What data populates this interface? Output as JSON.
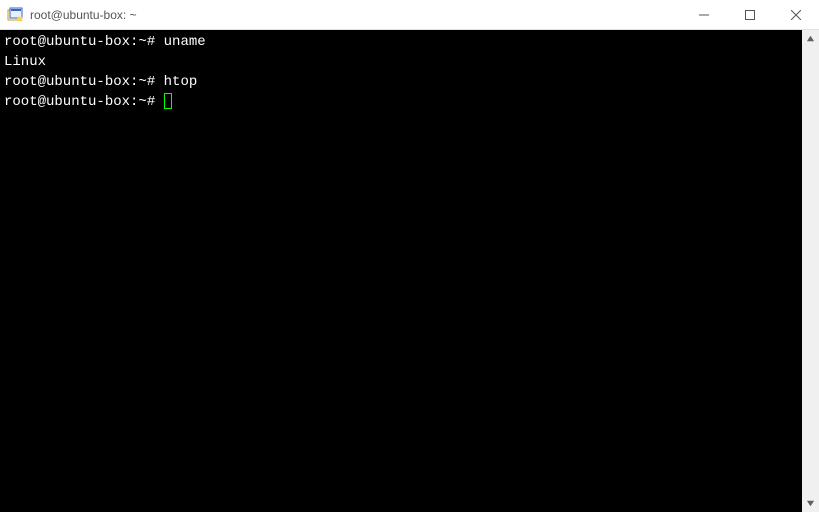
{
  "window": {
    "title": "root@ubuntu-box: ~"
  },
  "terminal": {
    "lines": [
      {
        "prompt": "root@ubuntu-box:~#",
        "cmd": " uname"
      },
      {
        "output": "Linux"
      },
      {
        "prompt": "root@ubuntu-box:~#",
        "cmd": " htop"
      },
      {
        "prompt": "root@ubuntu-box:~#",
        "cmd": " ",
        "cursor": true
      }
    ]
  }
}
